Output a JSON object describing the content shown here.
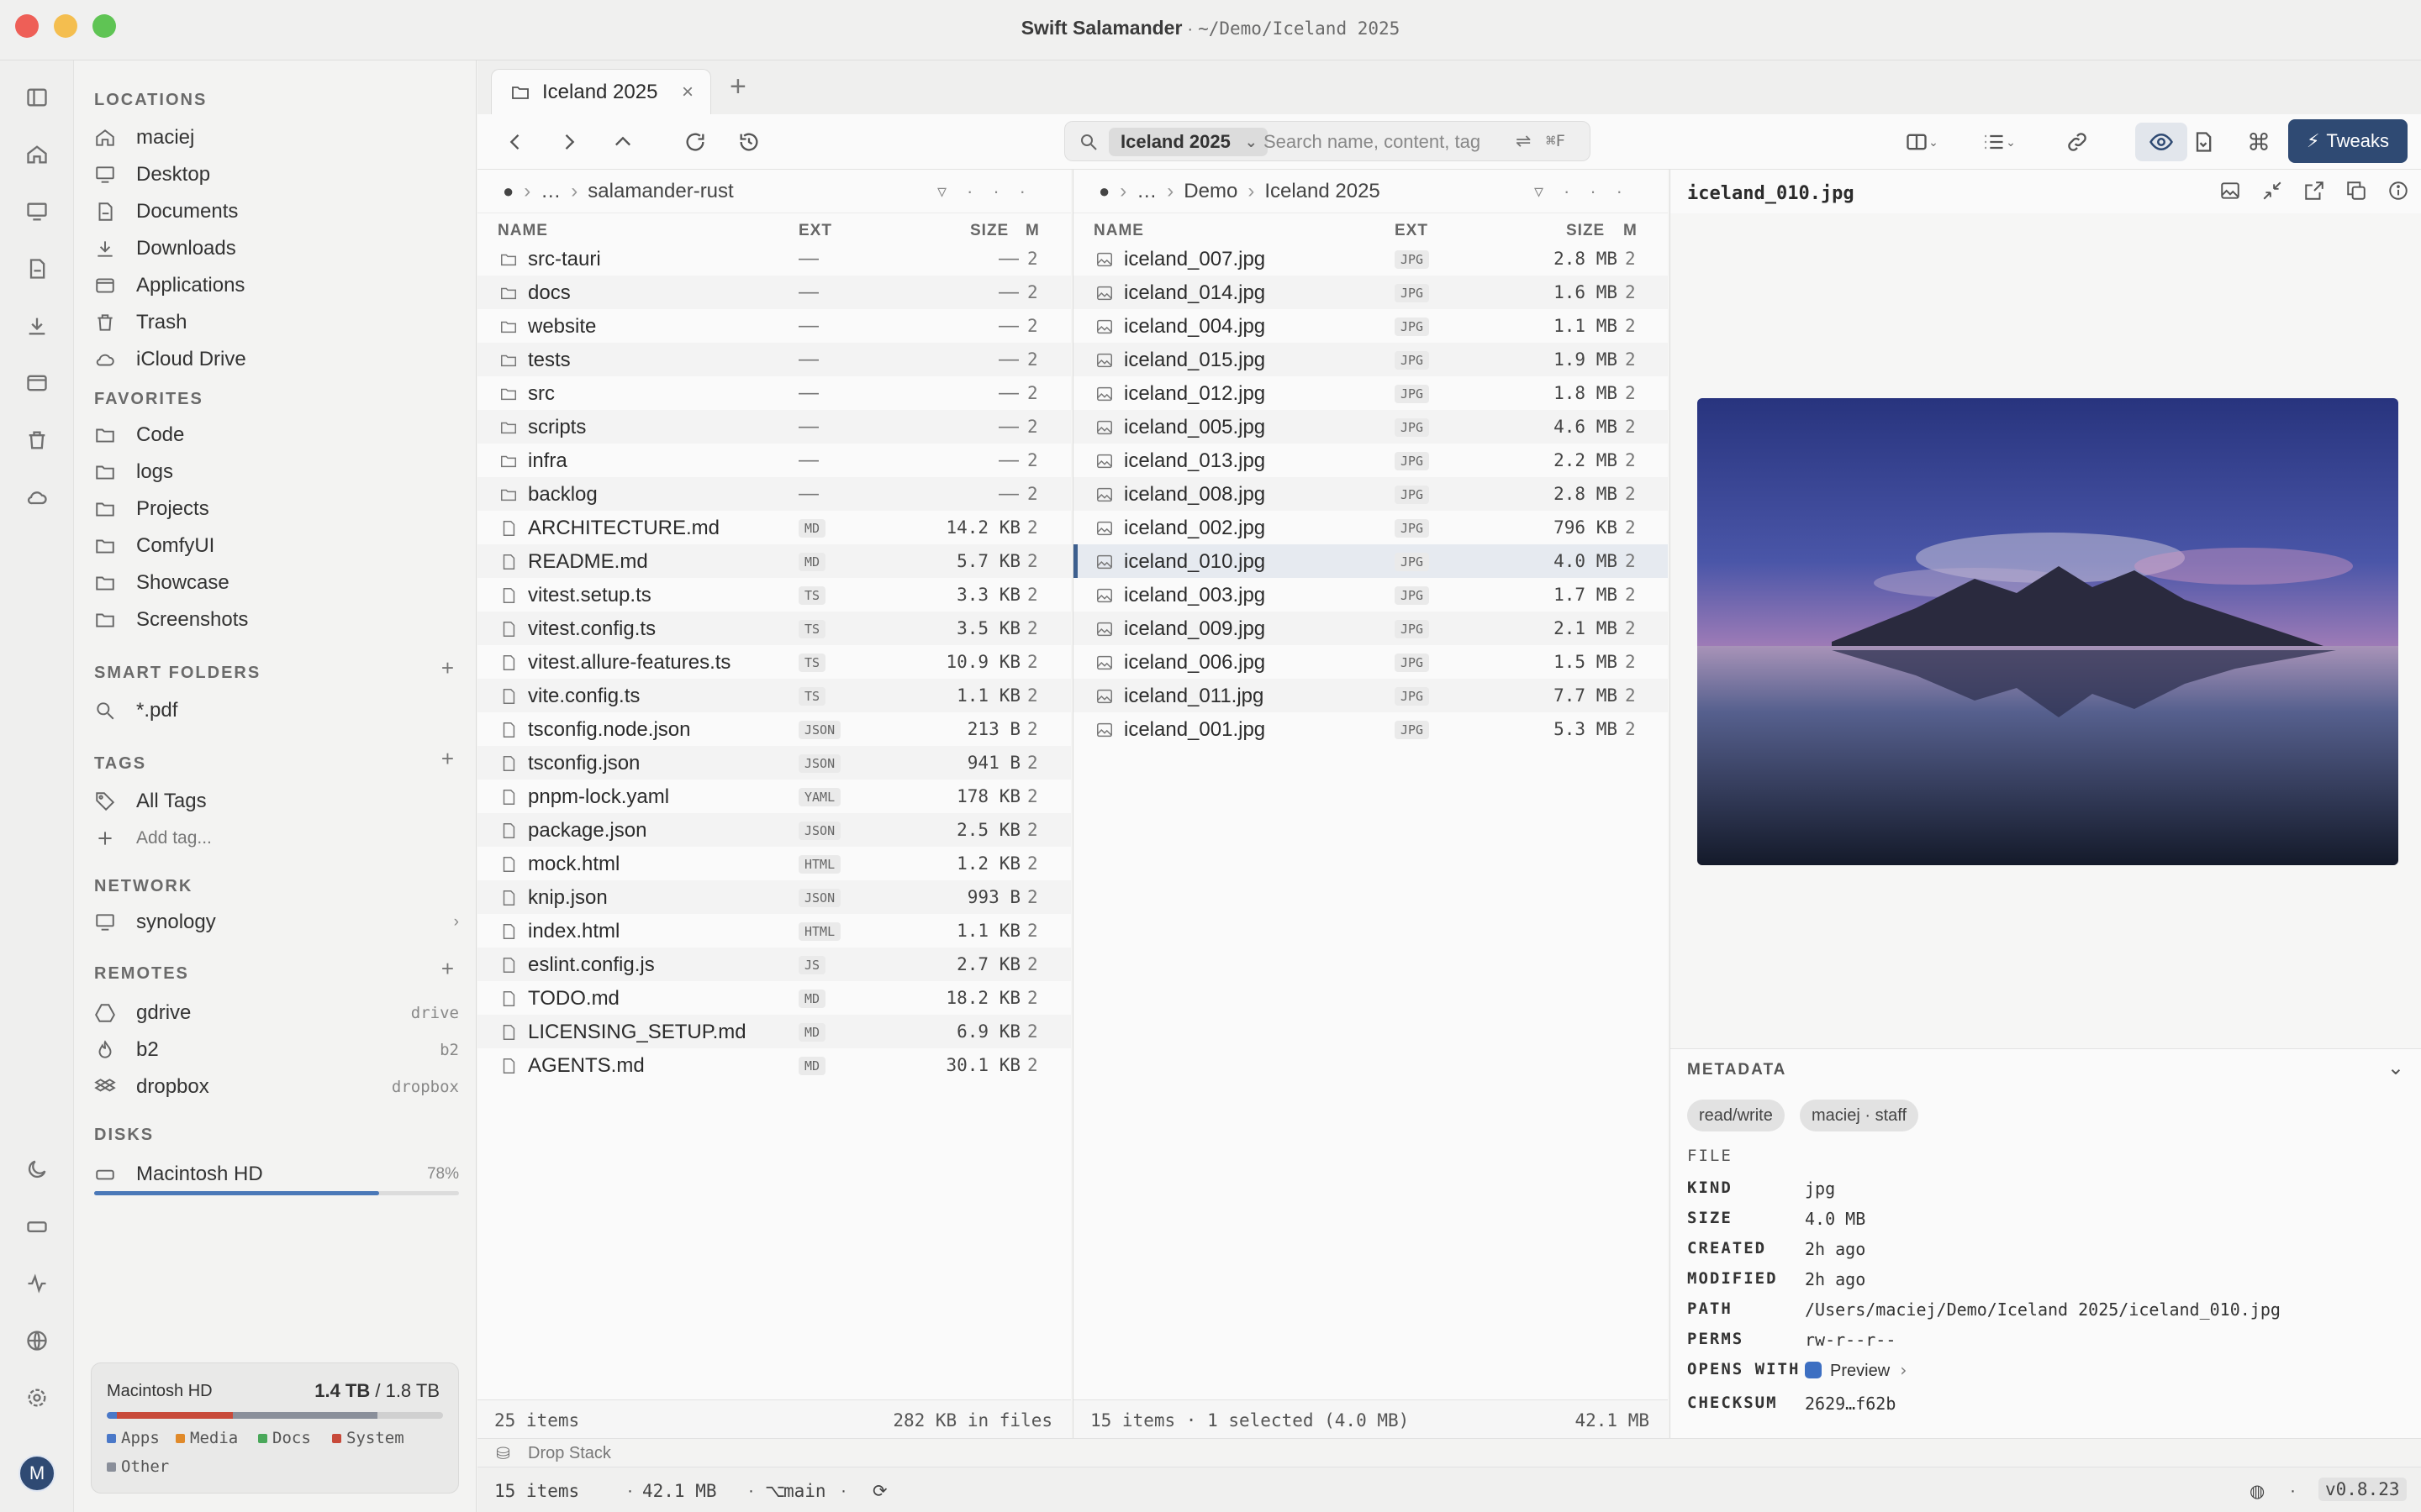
{
  "window": {
    "app_name": "Swift Salamander",
    "separator": " · ",
    "path": "~/Demo/Iceland 2025",
    "colors": {
      "close": "#ee5f57",
      "minimize": "#f4be4f",
      "maximize": "#5fc454",
      "accent": "#2f4a73"
    }
  },
  "rail": {
    "icons": [
      "sidebar-toggle-icon",
      "home-icon",
      "desktop-icon",
      "documents-icon",
      "downloads-icon",
      "applications-icon",
      "trash-icon",
      "cloud-icon",
      "moon-icon",
      "drive-icon",
      "activity-icon",
      "globe-icon",
      "settings-icon"
    ],
    "avatar": "M"
  },
  "sidebar": {
    "locations_title": "LOCATIONS",
    "locations": [
      {
        "label": "maciej",
        "icon": "home-icon"
      },
      {
        "label": "Desktop",
        "icon": "desktop-icon"
      },
      {
        "label": "Documents",
        "icon": "documents-icon"
      },
      {
        "label": "Downloads",
        "icon": "downloads-icon"
      },
      {
        "label": "Applications",
        "icon": "applications-icon"
      },
      {
        "label": "Trash",
        "icon": "trash-icon"
      },
      {
        "label": "iCloud Drive",
        "icon": "cloud-icon"
      }
    ],
    "favorites_title": "FAVORITES",
    "favorites": [
      "Code",
      "logs",
      "Projects",
      "ComfyUI",
      "Showcase",
      "Screenshots"
    ],
    "smart_title": "SMART FOLDERS",
    "smart": [
      "*.pdf"
    ],
    "tags_title": "TAGS",
    "tags": [
      "All Tags"
    ],
    "add_tag": "Add tag...",
    "network_title": "NETWORK",
    "network": [
      "synology"
    ],
    "remotes_title": "REMOTES",
    "remotes": [
      {
        "label": "gdrive",
        "hint": "drive"
      },
      {
        "label": "b2",
        "hint": "b2"
      },
      {
        "label": "dropbox",
        "hint": "dropbox"
      }
    ],
    "disks_title": "DISKS",
    "disk": {
      "label": "Macintosh HD",
      "percent": "78%",
      "fill": 0.78
    },
    "storage": {
      "name": "Macintosh HD",
      "used": "1.4 TB",
      "total": " / 1.8 TB",
      "legend": [
        {
          "label": "Apps",
          "color": "#4a78c8"
        },
        {
          "label": "Media",
          "color": "#e08a2a"
        },
        {
          "label": "Docs",
          "color": "#4aa85a"
        },
        {
          "label": "System",
          "color": "#c84a3a"
        },
        {
          "label": "Other",
          "color": "#8a8f9a"
        }
      ]
    }
  },
  "tabs": {
    "active": "Iceland 2025",
    "close": "×",
    "new": "+"
  },
  "toolbar": {
    "search_scope": "Iceland 2025",
    "search_placeholder": "Search name, content, tag",
    "search_shortcut": "⌘F",
    "tweaks": "Tweaks"
  },
  "left_pane": {
    "crumb": [
      "…",
      "salamander-rust"
    ],
    "columns": {
      "name": "NAME",
      "ext": "EXT",
      "size": "SIZE",
      "mod": "M"
    },
    "folders": [
      "src-tauri",
      "docs",
      "website",
      "tests",
      "src",
      "scripts",
      "infra",
      "backlog"
    ],
    "folder_dash": "—",
    "files": [
      {
        "name": "ARCHITECTURE.md",
        "ext": "MD",
        "size": "14.2 KB"
      },
      {
        "name": "README.md",
        "ext": "MD",
        "size": "5.7 KB"
      },
      {
        "name": "vitest.setup.ts",
        "ext": "TS",
        "size": "3.3 KB"
      },
      {
        "name": "vitest.config.ts",
        "ext": "TS",
        "size": "3.5 KB"
      },
      {
        "name": "vitest.allure-features.ts",
        "ext": "TS",
        "size": "10.9 KB"
      },
      {
        "name": "vite.config.ts",
        "ext": "TS",
        "size": "1.1 KB"
      },
      {
        "name": "tsconfig.node.json",
        "ext": "JSON",
        "size": "213 B"
      },
      {
        "name": "tsconfig.json",
        "ext": "JSON",
        "size": "941 B"
      },
      {
        "name": "pnpm-lock.yaml",
        "ext": "YAML",
        "size": "178 KB"
      },
      {
        "name": "package.json",
        "ext": "JSON",
        "size": "2.5 KB"
      },
      {
        "name": "mock.html",
        "ext": "HTML",
        "size": "1.2 KB"
      },
      {
        "name": "knip.json",
        "ext": "JSON",
        "size": "993 B"
      },
      {
        "name": "index.html",
        "ext": "HTML",
        "size": "1.1 KB"
      },
      {
        "name": "eslint.config.js",
        "ext": "JS",
        "size": "2.7 KB"
      },
      {
        "name": "TODO.md",
        "ext": "MD",
        "size": "18.2 KB"
      },
      {
        "name": "LICENSING_SETUP.md",
        "ext": "MD",
        "size": "6.9 KB"
      },
      {
        "name": "AGENTS.md",
        "ext": "MD",
        "size": "30.1 KB"
      }
    ],
    "cut_char": "2",
    "footer_left": "25 items",
    "footer_right": "282 KB in files"
  },
  "right_pane": {
    "crumb": [
      "…",
      "Demo",
      "Iceland 2025"
    ],
    "columns": {
      "name": "NAME",
      "ext": "EXT",
      "size": "SIZE",
      "mod": "M"
    },
    "files": [
      {
        "name": "iceland_007.jpg",
        "ext": "JPG",
        "size": "2.8 MB"
      },
      {
        "name": "iceland_014.jpg",
        "ext": "JPG",
        "size": "1.6 MB"
      },
      {
        "name": "iceland_004.jpg",
        "ext": "JPG",
        "size": "1.1 MB"
      },
      {
        "name": "iceland_015.jpg",
        "ext": "JPG",
        "size": "1.9 MB"
      },
      {
        "name": "iceland_012.jpg",
        "ext": "JPG",
        "size": "1.8 MB"
      },
      {
        "name": "iceland_005.jpg",
        "ext": "JPG",
        "size": "4.6 MB"
      },
      {
        "name": "iceland_013.jpg",
        "ext": "JPG",
        "size": "2.2 MB"
      },
      {
        "name": "iceland_008.jpg",
        "ext": "JPG",
        "size": "2.8 MB"
      },
      {
        "name": "iceland_002.jpg",
        "ext": "JPG",
        "size": "796 KB"
      },
      {
        "name": "iceland_010.jpg",
        "ext": "JPG",
        "size": "4.0 MB"
      },
      {
        "name": "iceland_003.jpg",
        "ext": "JPG",
        "size": "1.7 MB"
      },
      {
        "name": "iceland_009.jpg",
        "ext": "JPG",
        "size": "2.1 MB"
      },
      {
        "name": "iceland_006.jpg",
        "ext": "JPG",
        "size": "1.5 MB"
      },
      {
        "name": "iceland_011.jpg",
        "ext": "JPG",
        "size": "7.7 MB"
      },
      {
        "name": "iceland_001.jpg",
        "ext": "JPG",
        "size": "5.3 MB"
      }
    ],
    "selected_index": 9,
    "cut_char": "2",
    "footer_left": "15 items · 1 selected (4.0 MB)",
    "footer_right": "42.1 MB"
  },
  "preview": {
    "filename": "iceland_010.jpg",
    "metadata_title": "METADATA",
    "pills": [
      "read/write",
      "maciej · staff"
    ],
    "section": "FILE",
    "fields": [
      {
        "key": "KIND",
        "value": "jpg"
      },
      {
        "key": "SIZE",
        "value": "4.0 MB"
      },
      {
        "key": "CREATED",
        "value": "2h ago"
      },
      {
        "key": "MODIFIED",
        "value": "2h ago"
      },
      {
        "key": "PATH",
        "value": "/Users/maciej/Demo/Iceland 2025/iceland_010.jpg"
      },
      {
        "key": "PERMS",
        "value": "rw-r--r--"
      },
      {
        "key": "OPENS WITH",
        "value": "Preview"
      },
      {
        "key": "CHECKSUM",
        "value": "2629…f62b"
      }
    ]
  },
  "dropstack": "Drop Stack",
  "statusbar": {
    "items": "15 items",
    "dot": "·",
    "size": "42.1 MB",
    "branch": "main",
    "version": "v0.8.23"
  }
}
